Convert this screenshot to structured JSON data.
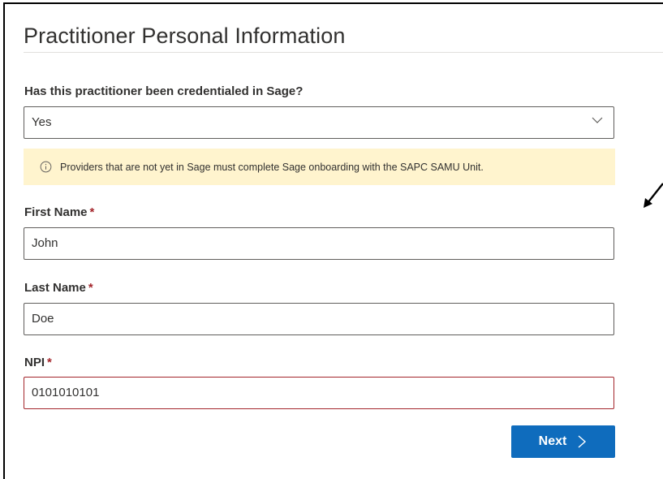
{
  "page": {
    "title": "Practitioner Personal Information"
  },
  "form": {
    "credentialed": {
      "label": "Has this practitioner been credentialed in Sage?",
      "selected": "Yes"
    },
    "info_message": "Providers that are not yet in Sage must complete Sage onboarding with the SAPC SAMU Unit.",
    "first_name": {
      "label": "First Name",
      "required_mark": "*",
      "value": "John"
    },
    "last_name": {
      "label": "Last Name",
      "required_mark": "*",
      "value": "Doe"
    },
    "npi": {
      "label": "NPI",
      "required_mark": "*",
      "value": "0101010101"
    },
    "next_label": "Next"
  },
  "icons": {
    "dropdown": "chevron-down-icon",
    "info": "info-icon",
    "next": "chevron-right-icon",
    "annotation": "arrow-annotation-icon"
  },
  "colors": {
    "primary_button": "#0f6cbd",
    "info_background": "#fff4ce",
    "error_border": "#a4262c",
    "required": "#a4262c",
    "text": "#323130"
  }
}
